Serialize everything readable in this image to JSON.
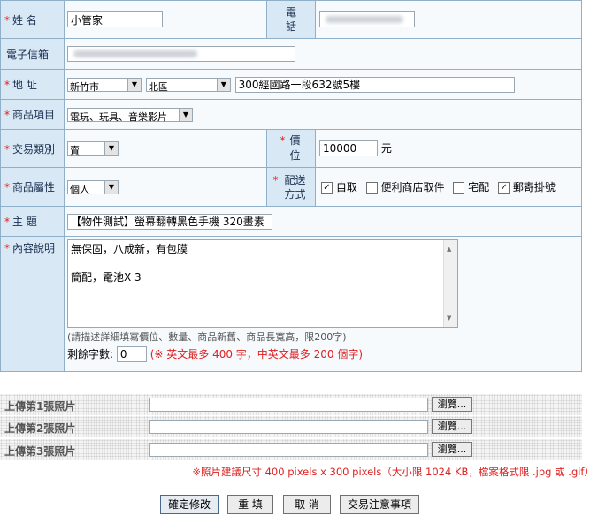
{
  "form": {
    "name": {
      "label": "姓 名",
      "value": "小管家"
    },
    "phone": {
      "label": "電 話"
    },
    "email": {
      "label": "電子信箱"
    },
    "address": {
      "label": "地 址",
      "city": "新竹市",
      "district": "北區",
      "street": "300經國路一段632號5樓"
    },
    "category": {
      "label": "商品項目",
      "value": "電玩、玩具、音樂影片"
    },
    "trade_type": {
      "label": "交易類別",
      "value": "賣"
    },
    "price": {
      "label": "價 位",
      "value": "10000",
      "unit": "元"
    },
    "attribute": {
      "label": "商品屬性",
      "value": "個人"
    },
    "delivery": {
      "label": "配送方式",
      "options": [
        {
          "label": "自取",
          "checked": true
        },
        {
          "label": "便利商店取件",
          "checked": false
        },
        {
          "label": "宅配",
          "checked": false
        },
        {
          "label": "郵寄掛號",
          "checked": true
        }
      ]
    },
    "subject": {
      "label": "主 題",
      "value": "【物件測試】螢幕翻轉黑色手機 320畫素"
    },
    "content": {
      "label": "內容說明",
      "line1": "無保固，八成新，有包膜",
      "line2": "簡配，電池X 3",
      "hint": "(請描述詳細填寫價位、數量、商品新舊、商品長寬高，限200字)",
      "remain_label": "剩餘字數:",
      "remain_value": "0",
      "limit_note": "(※ 英文最多 400 字，中英文最多 200 個字)"
    }
  },
  "uploads": [
    {
      "label": "上傳第1張照片",
      "browse": "瀏覽..."
    },
    {
      "label": "上傳第2張照片",
      "browse": "瀏覽..."
    },
    {
      "label": "上傳第3張照片",
      "browse": "瀏覽..."
    }
  ],
  "photo_note": "※照片建議尺寸 400 pixels x 300 pixels（大小限 1024 KB，檔案格式限 .jpg 或 .gif）",
  "buttons": {
    "confirm": "確定修改",
    "reset": "重 填",
    "cancel": "取 消",
    "notice": "交易注意事項"
  },
  "colors": {
    "label_bg": "#d8e8f4",
    "border": "#8fb0c8",
    "required": "#e02020"
  }
}
